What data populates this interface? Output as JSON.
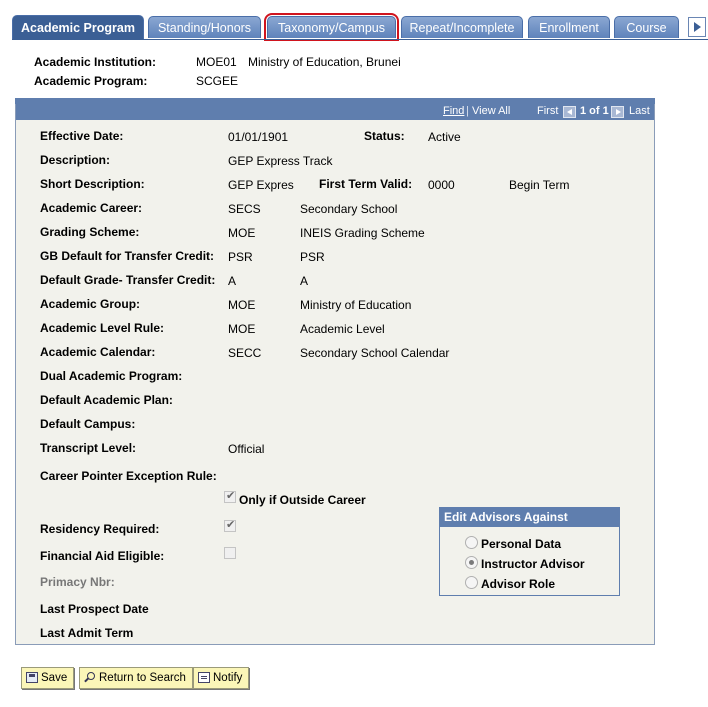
{
  "tabs": [
    {
      "label": "Academic Program",
      "active": true
    },
    {
      "label": "Standing/Honors",
      "active": false
    },
    {
      "label": "Taxonomy/Campus",
      "active": false,
      "highlighted": true
    },
    {
      "label": "Repeat/Incomplete",
      "active": false
    },
    {
      "label": "Enrollment",
      "active": false
    },
    {
      "label": "Course",
      "active": false
    }
  ],
  "header": {
    "institution_label": "Academic Institution:",
    "institution_code": "MOE01",
    "institution_name": "Ministry of Education, Brunei",
    "program_label": "Academic Program:",
    "program_code": "SCGEE"
  },
  "nav": {
    "find": "Find",
    "view_all": "View All",
    "first": "First",
    "count": "1 of 1",
    "last": "Last"
  },
  "fields": {
    "effective_date_label": "Effective Date:",
    "effective_date": "01/01/1901",
    "status_label": "Status:",
    "status": "Active",
    "description_label": "Description:",
    "description": "GEP Express Track",
    "short_desc_label": "Short Description:",
    "short_desc": "GEP Expres",
    "first_term_label": "First Term Valid:",
    "first_term": "0000",
    "first_term_desc": "Begin Term",
    "career_label": "Academic Career:",
    "career_code": "SECS",
    "career_desc": "Secondary School",
    "grading_label": "Grading Scheme:",
    "grading_code": "MOE",
    "grading_desc": "INEIS Grading Scheme",
    "gb_default_label": "GB Default for Transfer Credit:",
    "gb_default_code": "PSR",
    "gb_default_desc": "PSR",
    "default_grade_label": "Default Grade- Transfer Credit:",
    "default_grade_code": "A",
    "default_grade_desc": "A",
    "group_label": "Academic Group:",
    "group_code": "MOE",
    "group_desc": "Ministry of Education",
    "level_rule_label": "Academic Level Rule:",
    "level_rule_code": "MOE",
    "level_rule_desc": "Academic Level",
    "calendar_label": "Academic Calendar:",
    "calendar_code": "SECC",
    "calendar_desc": "Secondary School Calendar",
    "dual_label": "Dual Academic Program:",
    "default_plan_label": "Default Academic Plan:",
    "default_campus_label": "Default Campus:",
    "transcript_label": "Transcript Level:",
    "transcript": "Official",
    "career_pointer_label": "Career Pointer Exception Rule:",
    "only_outside_label": "Only if Outside Career",
    "residency_label": "Residency Required:",
    "financial_label": "Financial Aid Eligible:",
    "primacy_label": "Primacy Nbr:",
    "last_prospect_label": "Last Prospect Date",
    "last_admit_label": "Last Admit Term"
  },
  "advisors": {
    "title": "Edit Advisors Against",
    "options": [
      "Personal Data",
      "Instructor Advisor",
      "Advisor Role"
    ],
    "selected": "Instructor Advisor"
  },
  "buttons": {
    "save": "Save",
    "return": "Return to Search",
    "notify": "Notify"
  }
}
